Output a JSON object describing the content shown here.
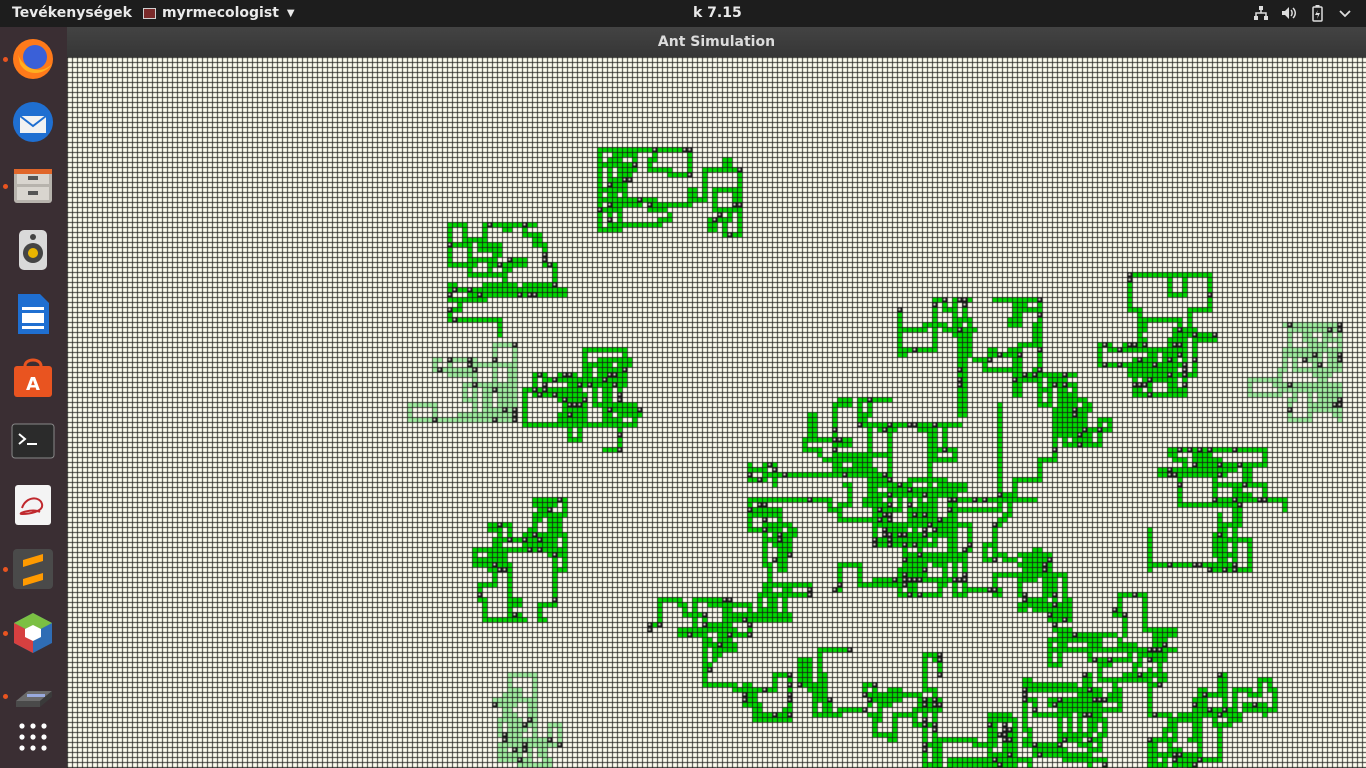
{
  "topbar": {
    "activities": "Tevékenységek",
    "app_name": "myrmecologist",
    "clock": "k  7.15"
  },
  "dock": {
    "items": [
      {
        "name": "firefox",
        "running": true
      },
      {
        "name": "thunderbird",
        "running": false
      },
      {
        "name": "files",
        "running": true
      },
      {
        "name": "rhythmbox",
        "running": false
      },
      {
        "name": "writer",
        "running": false
      },
      {
        "name": "software",
        "running": false
      },
      {
        "name": "terminal",
        "running": false
      },
      {
        "name": "evince",
        "running": false
      },
      {
        "name": "sublime",
        "running": true
      },
      {
        "name": "virtualbox",
        "running": true
      },
      {
        "name": "scanner",
        "running": true
      },
      {
        "name": "show-apps",
        "running": false
      }
    ]
  },
  "window": {
    "title": "Ant Simulation"
  },
  "colors": {
    "grid_background": "#fffef0",
    "grid_lines": "#1a1a1a",
    "pheromone_strong": "#00dd00",
    "pheromone_faint": "#a0f0a0",
    "ant": "#111111",
    "accent": "#e95420"
  }
}
